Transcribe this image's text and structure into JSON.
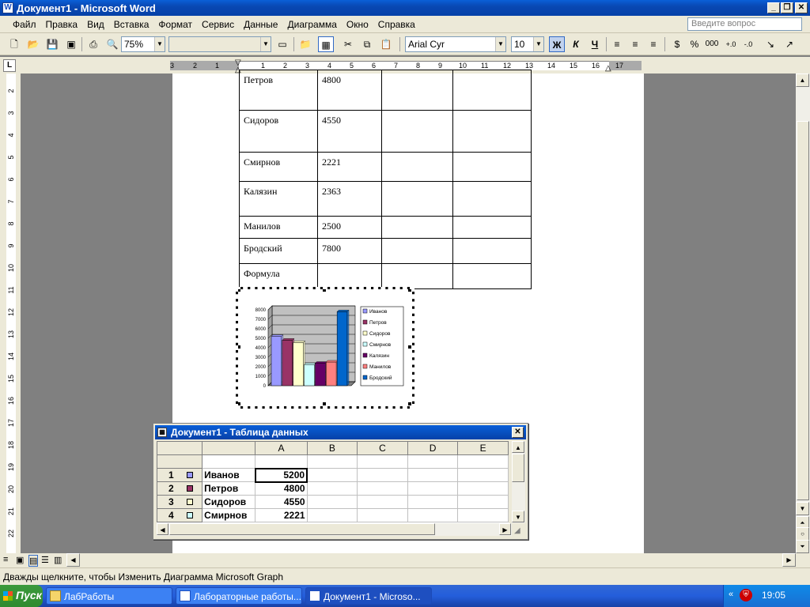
{
  "window": {
    "title": "Документ1 - Microsoft Word",
    "help_placeholder": "Введите вопрос"
  },
  "menu": [
    "Файл",
    "Правка",
    "Вид",
    "Вставка",
    "Формат",
    "Сервис",
    "Данные",
    "Диаграмма",
    "Окно",
    "Справка"
  ],
  "toolbar": {
    "zoom": "75%",
    "font_name": "Arial Cyr",
    "font_size": "10",
    "bold": "Ж",
    "italic": "К",
    "underline": "Ч",
    "percent": "%",
    "thousands": "000"
  },
  "ruler": {
    "h_labels": [
      "3",
      "2",
      "1",
      "1",
      "2",
      "3",
      "4",
      "5",
      "6",
      "7",
      "8",
      "9",
      "10",
      "11",
      "12",
      "13",
      "14",
      "15",
      "16",
      "17"
    ],
    "v_labels": [
      "2",
      "3",
      "4",
      "5",
      "6",
      "7",
      "8",
      "9",
      "10",
      "11",
      "12",
      "13",
      "14",
      "15",
      "16",
      "17",
      "18",
      "19",
      "20",
      "21",
      "22"
    ],
    "corner": "L"
  },
  "doc_table": [
    {
      "name": "Петров",
      "value": "4800"
    },
    {
      "name": "Сидоров",
      "value": "4550"
    },
    {
      "name": "Смирнов",
      "value": "2221"
    },
    {
      "name": "Калязин",
      "value": "2363"
    },
    {
      "name": "Манилов",
      "value": "2500"
    },
    {
      "name": "Бродский",
      "value": "7800"
    },
    {
      "name": "Формула",
      "value": ""
    }
  ],
  "chart_data": {
    "type": "bar",
    "title": "",
    "xlabel": "",
    "ylabel": "",
    "ylim": [
      0,
      8000
    ],
    "yticks": [
      "0",
      "1000",
      "2000",
      "3000",
      "4000",
      "5000",
      "6000",
      "7000",
      "8000"
    ],
    "legend_position": "right",
    "series": [
      {
        "name": "Иванов",
        "values": [
          5200
        ],
        "color": "#9999ff"
      },
      {
        "name": "Петров",
        "values": [
          4800
        ],
        "color": "#993366"
      },
      {
        "name": "Сидоров",
        "values": [
          4550
        ],
        "color": "#ffffcc"
      },
      {
        "name": "Смирнов",
        "values": [
          2221
        ],
        "color": "#ccffff"
      },
      {
        "name": "Калязин",
        "values": [
          2363
        ],
        "color": "#660066"
      },
      {
        "name": "Манилов",
        "values": [
          2500
        ],
        "color": "#ff8080"
      },
      {
        "name": "Бродский",
        "values": [
          7800
        ],
        "color": "#0066cc"
      }
    ]
  },
  "datasheet": {
    "title": "Документ1 - Таблица данных",
    "columns": [
      "A",
      "B",
      "C",
      "D",
      "E"
    ],
    "rows": [
      {
        "num": "1",
        "name": "Иванов",
        "value": "5200"
      },
      {
        "num": "2",
        "name": "Петров",
        "value": "4800"
      },
      {
        "num": "3",
        "name": "Сидоров",
        "value": "4550"
      },
      {
        "num": "4",
        "name": "Смирнов",
        "value": "2221"
      }
    ]
  },
  "status": {
    "text": "Дважды щелкните, чтобы Изменить Диаграмма Microsoft Graph"
  },
  "taskbar": {
    "start": "Пуск",
    "tasks": [
      "ЛабРаботы",
      "Лабораторные работы...",
      "Документ1 - Microsо..."
    ],
    "lang": "RU",
    "clock": "19:05"
  }
}
